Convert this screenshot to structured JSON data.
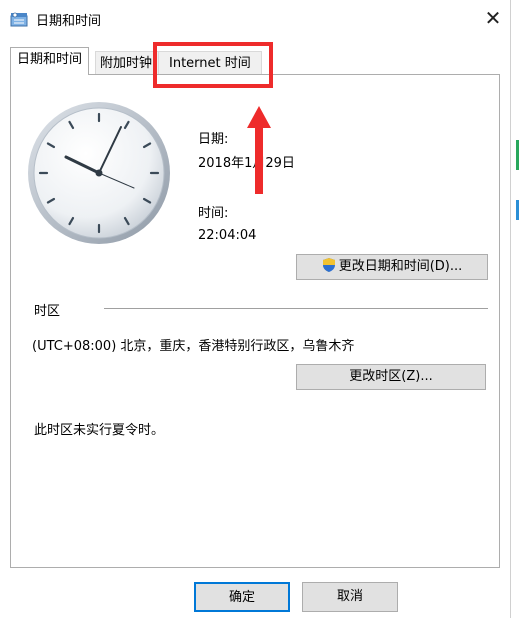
{
  "window": {
    "title": "日期和时间"
  },
  "tabs": [
    {
      "label": "日期和时间",
      "active": true
    },
    {
      "label": "附加时钟",
      "active": false
    },
    {
      "label": "Internet 时间",
      "active": false
    }
  ],
  "datetime": {
    "date_label": "日期:",
    "date_value": "2018年1月29日",
    "time_label": "时间:",
    "time_value": "22:04:04",
    "change_button": "更改日期和时间(D)..."
  },
  "timezone": {
    "section_label": "时区",
    "value": "(UTC+08:00) 北京，重庆，香港特别行政区，乌鲁木齐",
    "change_button": "更改时区(Z)...",
    "dst_note": "此时区未实行夏令时。"
  },
  "footer": {
    "ok_label": "确定",
    "cancel_label": "取消"
  },
  "annotation": {
    "color": "#ee2b2b"
  },
  "icons": {
    "window": "clock-app-icon",
    "close": "close-icon",
    "uac": "uac-shield-icon"
  }
}
